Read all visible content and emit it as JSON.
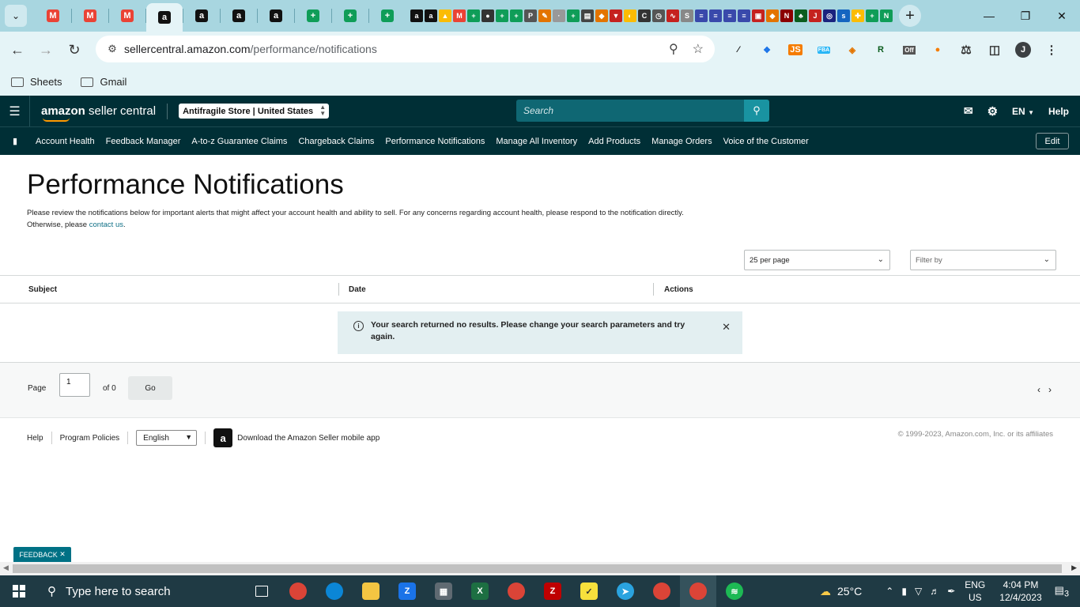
{
  "browser": {
    "tab_icons": [
      {
        "name": "gmail-tab-icon",
        "glyph": "M",
        "color": "#ea4335"
      },
      {
        "name": "gmail-tab-icon",
        "glyph": "M",
        "color": "#ea4335"
      },
      {
        "name": "gmail-tab-icon",
        "glyph": "M",
        "color": "#ea4335"
      },
      {
        "name": "amazon-tab-icon",
        "glyph": "a",
        "color": "#111111",
        "active": true
      },
      {
        "name": "amazon-tab-icon",
        "glyph": "a",
        "color": "#111111"
      },
      {
        "name": "amazon-tab-icon",
        "glyph": "a",
        "color": "#111111"
      },
      {
        "name": "amazon-tab-icon",
        "glyph": "a",
        "color": "#111111"
      },
      {
        "name": "sheets-tab-icon",
        "glyph": "+",
        "color": "#0f9d58"
      },
      {
        "name": "sheets-tab-icon",
        "glyph": "+",
        "color": "#0f9d58"
      },
      {
        "name": "sheets-tab-icon",
        "glyph": "+",
        "color": "#0f9d58"
      }
    ],
    "url_host": "sellercentral.amazon.com",
    "url_path": "/performance/notifications",
    "bookmarks": [
      "Sheets",
      "Gmail"
    ],
    "profile_initial": "J"
  },
  "header": {
    "logo_text_bold": "amazon",
    "logo_text": " seller central",
    "store_selector": "Antifragile Store | United States",
    "search_placeholder": "Search",
    "language": "EN",
    "help": "Help"
  },
  "nav": {
    "links": [
      "Account Health",
      "Feedback Manager",
      "A-to-z Guarantee Claims",
      "Chargeback Claims",
      "Performance Notifications",
      "Manage All Inventory",
      "Add Products",
      "Manage Orders",
      "Voice of the Customer"
    ],
    "edit": "Edit"
  },
  "main": {
    "title": "Performance Notifications",
    "description": "Please review the notifications below for important alerts that might affect your account health and ability to sell. For any concerns regarding account health, please respond to the notification directly. Otherwise, please ",
    "contact_link": "contact us",
    "description_end": ".",
    "per_page": "25 per page",
    "filter_placeholder": "Filter by",
    "columns": [
      "Subject",
      "Date",
      "Actions"
    ],
    "alert_message": "Your search returned no results. Please change your search parameters and try again."
  },
  "pager": {
    "page_label": "Page",
    "page_value": "1",
    "of_label": "of 0",
    "go": "Go"
  },
  "footer": {
    "help": "Help",
    "program_policies": "Program Policies",
    "language": "English",
    "app_promo": "Download the Amazon Seller mobile app",
    "copyright": "© 1999-2023, Amazon.com, Inc. or its affiliates"
  },
  "feedback": "FEEDBACK",
  "taskbar": {
    "search_placeholder": "Type here to search",
    "temperature": "25°C",
    "lang_top": "ENG",
    "lang_bottom": "US",
    "time": "4:04 PM",
    "date": "12/4/2023",
    "notifications": "3"
  }
}
